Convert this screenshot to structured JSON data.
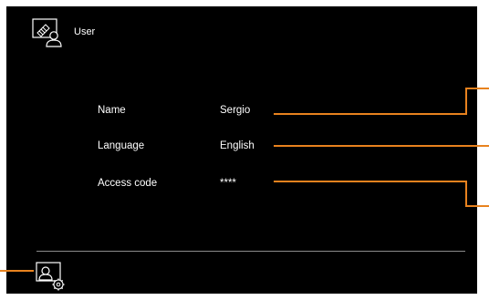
{
  "header": {
    "title": "User",
    "icon": "user-edit-icon"
  },
  "fields": [
    {
      "label": "Name",
      "value": "Sergio"
    },
    {
      "label": "Language",
      "value": "English"
    },
    {
      "label": "Access code",
      "value": "****"
    }
  ],
  "footer": {
    "icon": "user-settings-icon"
  },
  "colors": {
    "screen_bg": "#000000",
    "text": "#ffffff",
    "callout": "#e8821e",
    "divider": "#8a8a8a"
  }
}
